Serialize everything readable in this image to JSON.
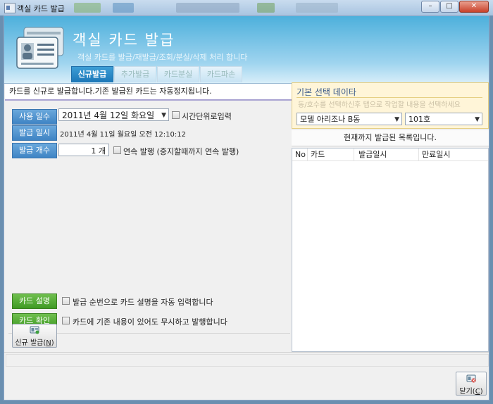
{
  "window": {
    "title": "객실 카드 발급",
    "minimize": "–",
    "maximize": "□",
    "close": "✕"
  },
  "banner": {
    "title": "객실 카드 발급",
    "subtitle": "객실 카드를 발급/재발급/조회/분실/삭제 처리 합니다"
  },
  "tabs": [
    {
      "label": "신규발급",
      "active": true
    },
    {
      "label": "추가발급",
      "active": false
    },
    {
      "label": "카드분실",
      "active": false
    },
    {
      "label": "카드파손",
      "active": false
    }
  ],
  "info_text": "카드를 신규로 발급합니다.기존 발급된 카드는 자동정지됩니다.",
  "form": {
    "usage_days_label": "사용 일수",
    "usage_date": "2011년   4월 12일 화요일",
    "time_unit_label": "시간단위로입력",
    "issue_time_label": "발급 일시",
    "issue_time_value": "2011년 4월 11일 월요일 오전 12:10:12",
    "issue_count_label": "발급 개수",
    "issue_count_value": "1",
    "issue_count_unit": "개",
    "continuous_label": "연속 발행 (중지할때까지 연속 발행)",
    "card_desc_button": "카드 설명",
    "card_desc_check": "발급 순번으로 카드 설명을 자동 입력합니다",
    "card_confirm_button": "카드 확인",
    "card_confirm_check": "카드에 기존 내용이 있어도 무시하고 발행합니다",
    "new_issue_button": "신규 발급(N)",
    "new_issue_text": "신규 발급(",
    "new_issue_key": "N",
    "new_issue_end": ")"
  },
  "right_panel": {
    "header": "기본 선택 데이타",
    "hint": "동/호수를 선택하신후 탭으로 작업할 내용을 선택하세요",
    "building": "모델 아리조나 B동",
    "room": "101호",
    "list_title": "현재까지 발급된 목록입니다.",
    "columns": [
      "No",
      "카드",
      "발급일시",
      "만료일시"
    ]
  },
  "close_button": {
    "text": "닫기(",
    "key": "C",
    "end": ")"
  },
  "colors": {
    "accent": "#1c77b8",
    "banner": "#4db0dc",
    "green_button": "#3f9a24",
    "yellow_panel": "#fff5d8"
  }
}
